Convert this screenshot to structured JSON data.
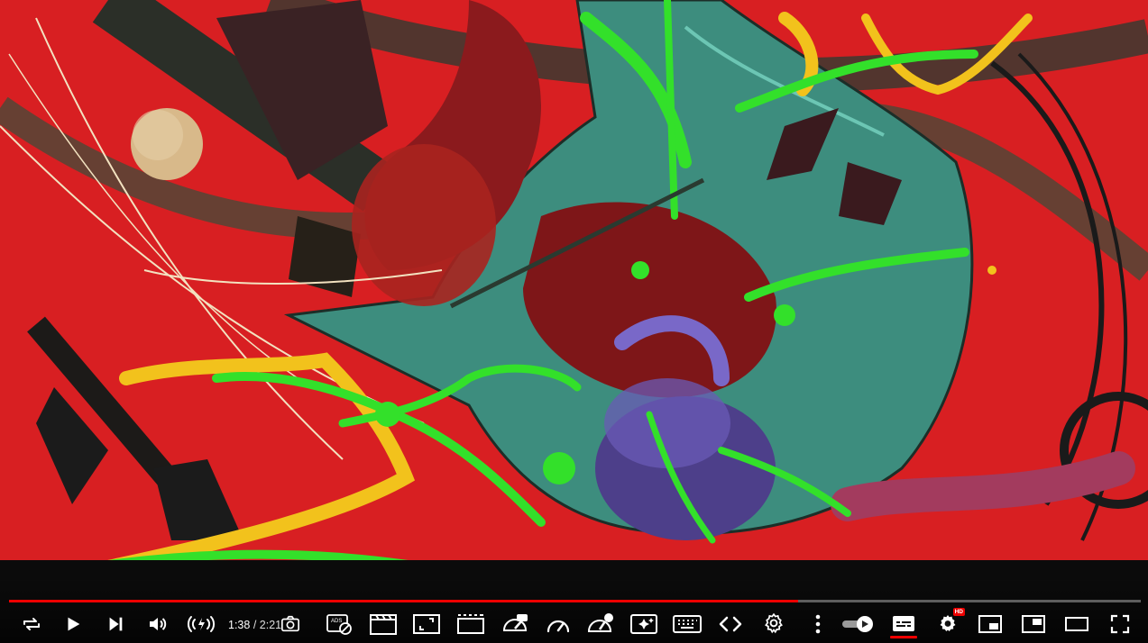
{
  "player": {
    "progress_fraction": 0.697,
    "time": {
      "current": "1:38",
      "separator": " / ",
      "duration": "2:21"
    }
  },
  "colors": {
    "progress_played": "#ee0000",
    "artwork_bg": "#d81f22",
    "accent_green": "#33e02a",
    "accent_yellow": "#f2c21c",
    "teal": "#3d8d7e"
  },
  "controls": {
    "left": [
      {
        "name": "loop-icon",
        "label": "Loop"
      },
      {
        "name": "play-icon",
        "label": "Play"
      },
      {
        "name": "next-icon",
        "label": "Next"
      },
      {
        "name": "volume-icon",
        "label": "Mute"
      },
      {
        "name": "audio-enhance-icon",
        "label": "Audio"
      },
      {
        "name": "screenshot-icon",
        "label": "Screenshot"
      }
    ],
    "extension_icons": [
      "ads-block-icon",
      "clapperboard-icon",
      "frame-size-icon",
      "cinema-mode-icon",
      "speed-badge-icon",
      "speedometer-icon",
      "speed-pro-icon",
      "sparkle-icon",
      "keyboard-icon",
      "code-icon",
      "gear-icon"
    ],
    "right": [
      {
        "name": "more-options-icon",
        "label": "More"
      },
      {
        "name": "autoplay-toggle",
        "label": "Autoplay"
      },
      {
        "name": "subtitles-icon",
        "label": "Subtitles"
      },
      {
        "name": "settings-icon",
        "label": "Settings",
        "badge": "HD"
      },
      {
        "name": "miniplayer-icon",
        "label": "Miniplayer"
      },
      {
        "name": "pip-icon",
        "label": "Picture-in-picture"
      },
      {
        "name": "theater-mode-icon",
        "label": "Theater mode"
      },
      {
        "name": "fullscreen-icon",
        "label": "Full screen"
      }
    ]
  }
}
